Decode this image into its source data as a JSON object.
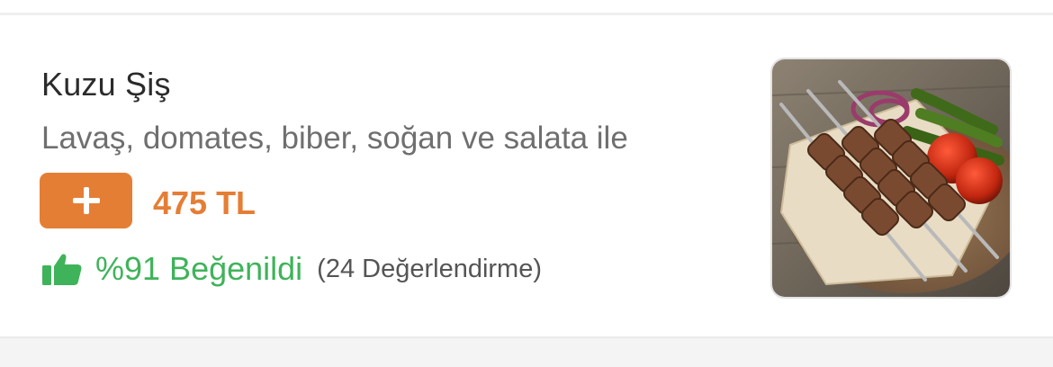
{
  "item": {
    "name": "Kuzu Şiş",
    "description": "Lavaş, domates, biber, soğan ve salata ile",
    "price": "475 TL",
    "rating_text": "%91 Beğenildi",
    "rating_count": "(24 Değerlendirme)",
    "image": "lamb-kebab-photo"
  },
  "colors": {
    "accent": "#e57e35",
    "rating_green": "#3fb35a"
  },
  "icons": {
    "add": "plus-icon",
    "rating": "thumbs-up-icon"
  }
}
